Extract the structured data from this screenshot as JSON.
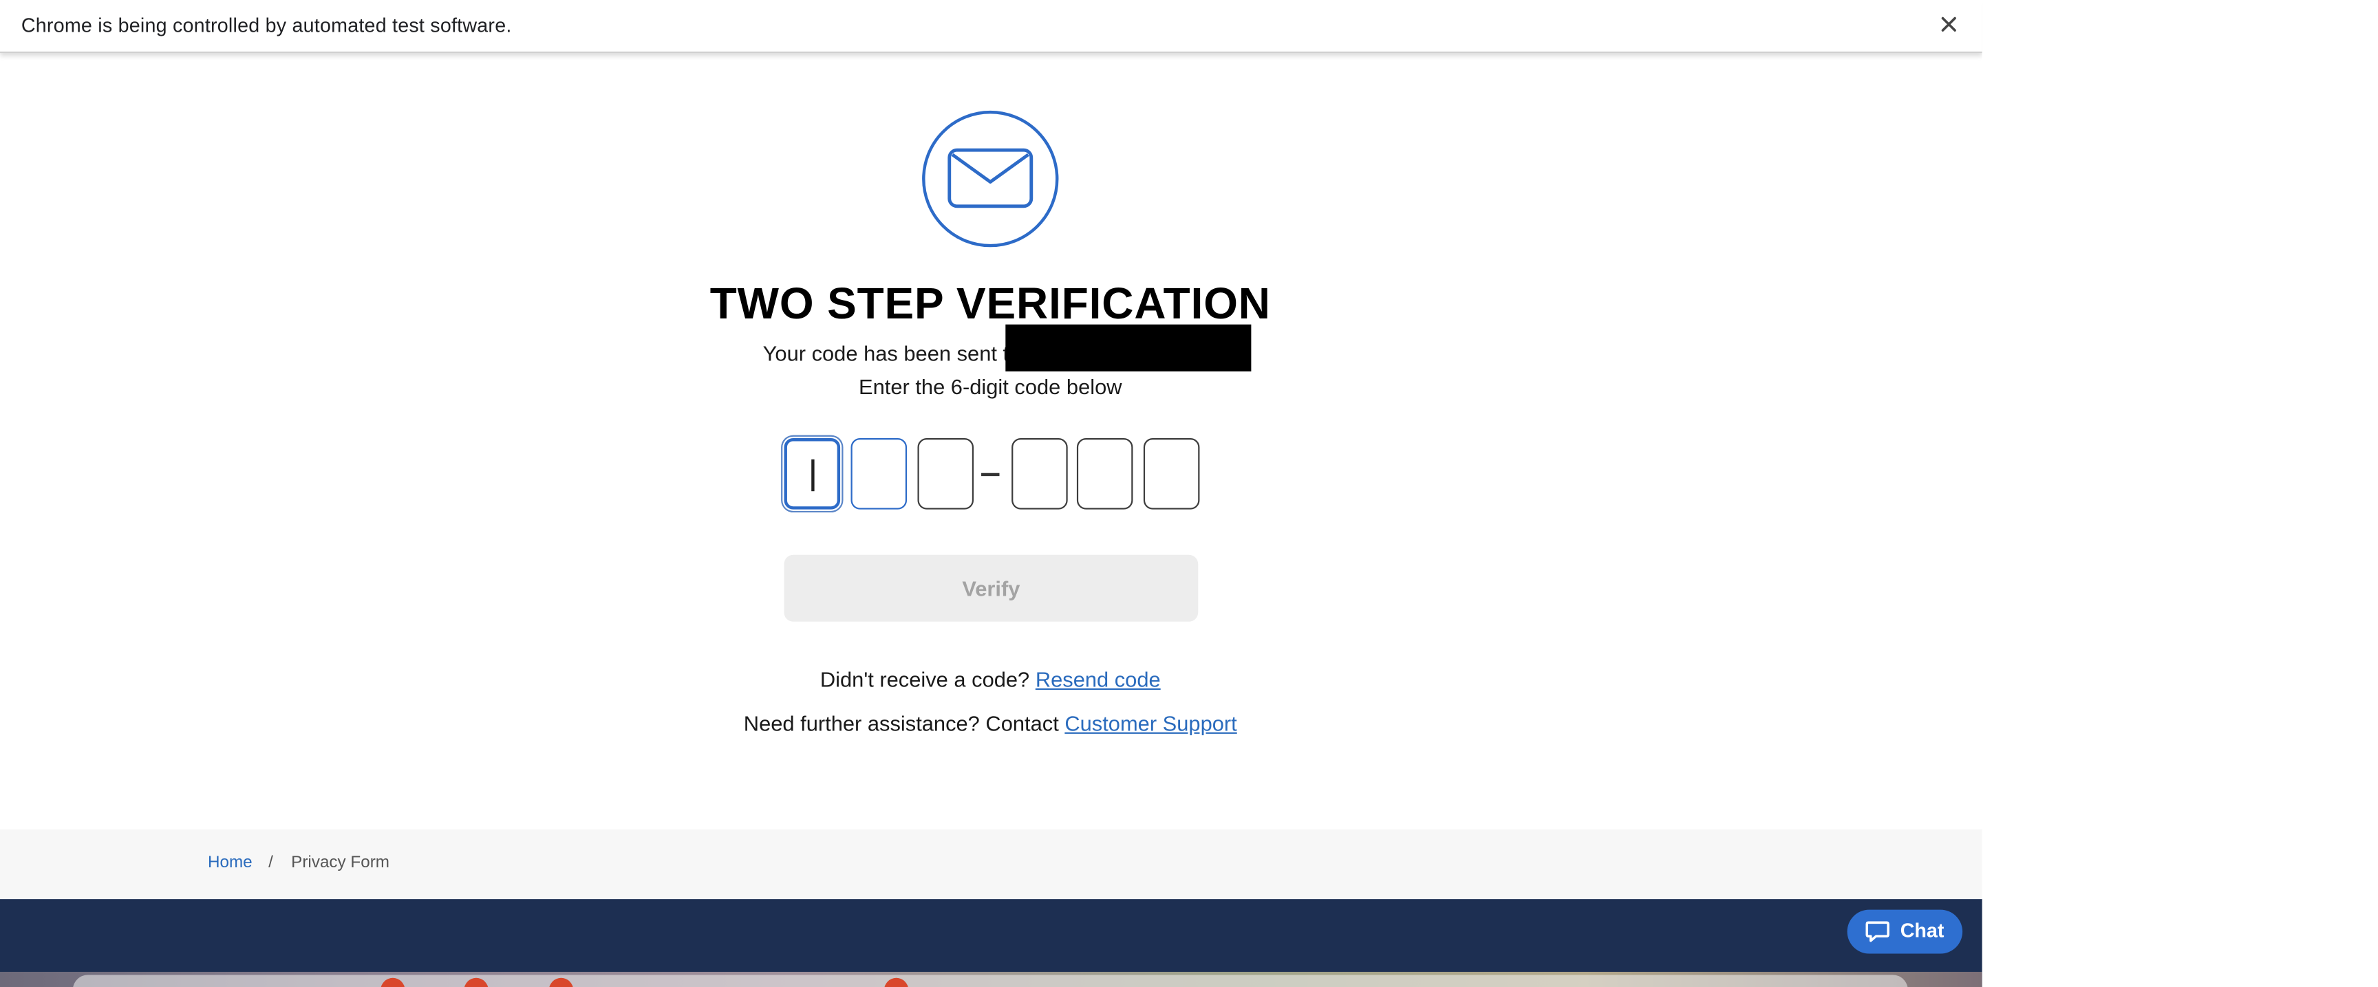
{
  "infobar": {
    "message": "Chrome is being controlled by automated test software.",
    "close_icon": "close-icon"
  },
  "verification": {
    "icon": "envelope-icon",
    "title": "TWO STEP VERIFICATION",
    "sent_text": "Your code has been sent to",
    "instruction": "Enter the 6-digit code below",
    "code_digits": [
      "",
      "",
      "",
      "",
      "",
      ""
    ],
    "verify_label": "Verify",
    "resend_prompt": "Didn't receive a code?",
    "resend_link": "Resend code",
    "support_prompt": "Need further assistance? Contact",
    "support_link": "Customer Support"
  },
  "breadcrumb": {
    "home": "Home",
    "separator": "/",
    "current": "Privacy Form"
  },
  "chat": {
    "label": "Chat",
    "icon": "chat-bubble-icon"
  },
  "colors": {
    "accent": "#2e6fd0",
    "link": "#2a6bbd",
    "footer": "#1d2f52",
    "button_disabled": "#ededed"
  }
}
